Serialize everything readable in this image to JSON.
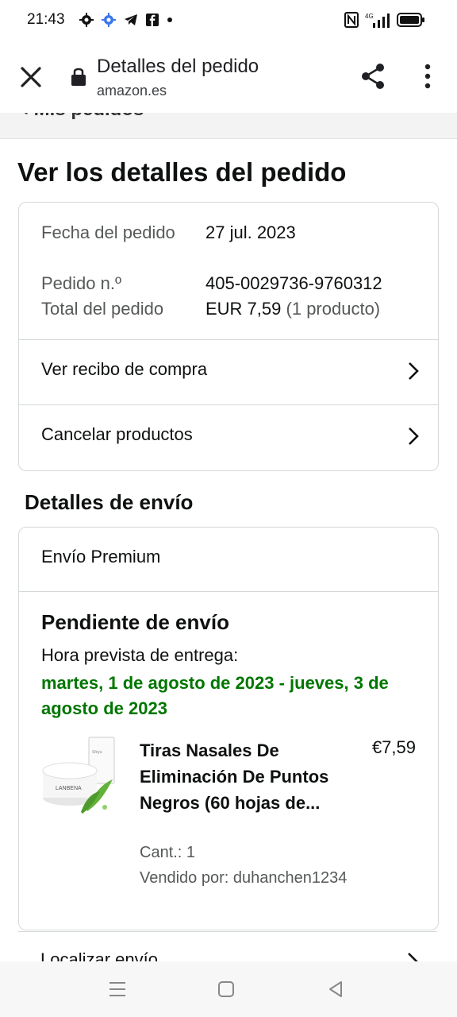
{
  "status_bar": {
    "time": "21:43",
    "network": "4G"
  },
  "browser": {
    "title": "Detalles del pedido",
    "url": "amazon.es"
  },
  "breadcrumb": "‹ Mis pedidos",
  "heading": "Ver los detalles del pedido",
  "order_summary": {
    "rows": [
      {
        "label": "Fecha del pedido",
        "value": "27 jul. 2023"
      },
      {
        "label": "Pedido n.º",
        "value": "405-0029736-9760312"
      },
      {
        "label": "Total del pedido",
        "value": "EUR 7,59",
        "extra": "(1 producto)"
      }
    ],
    "link_receipt": "Ver recibo de compra",
    "link_cancel": "Cancelar productos"
  },
  "shipping": {
    "section_title": "Detalles de envío",
    "type": "Envío Premium",
    "status": "Pendiente de envío",
    "eta_label": "Hora prevista de entrega:",
    "eta_value": "martes, 1 de agosto de 2023 - jueves, 3 de agosto de 2023",
    "product": {
      "title": "Tiras Nasales De Eliminación De Puntos Negros (60 hojas de...",
      "price": "€7,59",
      "quantity": "Cant.: 1",
      "seller": "Vendido por: duhanchen1234",
      "brand_on_image": "LANBENA"
    },
    "track_link": "Localizar envío"
  },
  "colors": {
    "accent_green": "#007600",
    "border": "#d5d9d9",
    "muted_text": "#565959"
  }
}
